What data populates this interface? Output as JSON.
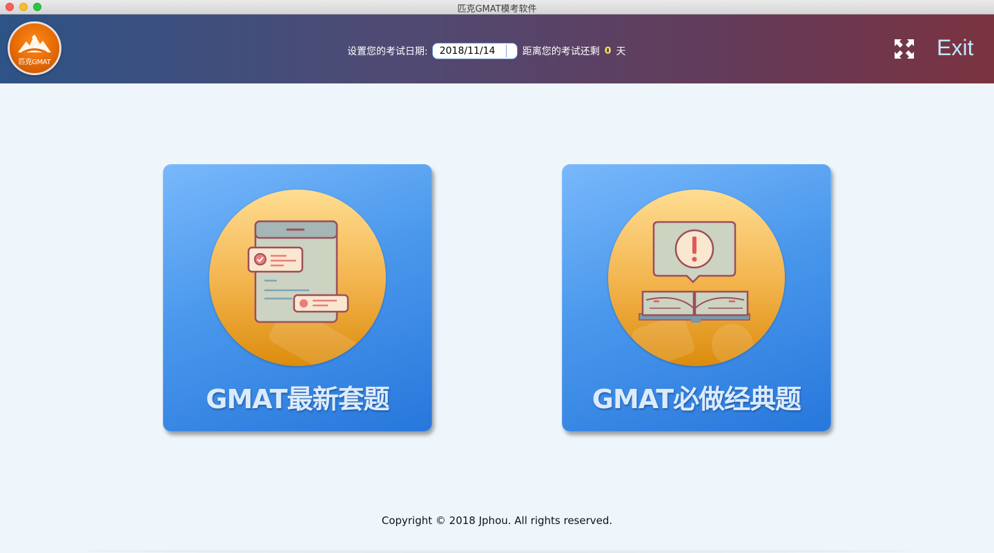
{
  "window": {
    "title": "匹克GMAT模考软件"
  },
  "header": {
    "logo_text": "匹克GMAT",
    "date_label": "设置您的考试日期:",
    "date_value": "2018/11/14",
    "remain_label": "距离您的考试还剩",
    "remain_days": "0",
    "remain_unit": "天",
    "exit_label": "Exit"
  },
  "cards": [
    {
      "title": "GMAT最新套题",
      "icon": "tablet-checklist-icon"
    },
    {
      "title": "GMAT必做经典题",
      "icon": "book-alert-icon"
    }
  ],
  "footer": {
    "copyright": "Copyright © 2018 Jphou. All rights reserved."
  },
  "colors": {
    "header_start": "#2e5386",
    "header_end": "#7b3340",
    "card_blue": "#4a98ec",
    "circle_gold": "#f2b24a",
    "days_highlight": "#f7e64a",
    "exit_text": "#bfe8ff"
  }
}
